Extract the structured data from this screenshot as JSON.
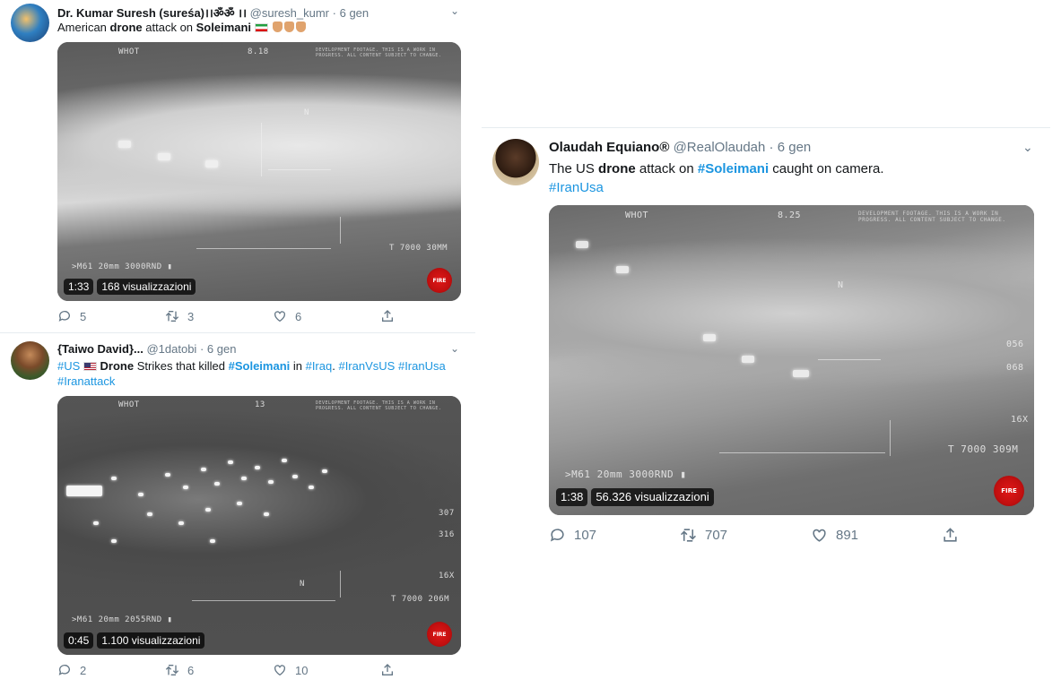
{
  "tweets": [
    {
      "name": "Dr. Kumar Suresh (sureśa)।।ॐॐ ।।",
      "handle": "@suresh_kumr",
      "time": "6 gen",
      "text": {
        "a": "American ",
        "b": "drone",
        "c": " attack on ",
        "d": "Soleimani"
      },
      "video": {
        "duration": "1:33",
        "views": "168 visualizzazioni"
      },
      "hud": {
        "mode": "WHOT",
        "top": "8.18",
        "north": "N",
        "range": "T 7000 30MM",
        "weapon": ">M61 20mm    3000RND ▮",
        "fire": "FIRE"
      },
      "actions": {
        "replies": "5",
        "retweets": "3",
        "likes": "6"
      }
    },
    {
      "name": "{Taiwo David}...",
      "handle": "@1datobi",
      "time": "6 gen",
      "text": {
        "t1": "#US",
        "t2": " ",
        "t3": "Drone",
        "t4": " Strikes that killed ",
        "t5": "#Soleimani",
        "t6": "  in ",
        "t7": "#Iraq",
        "t8": ". ",
        "t9": "#IranVsUS",
        "t10": " ",
        "t11": "#IranUsa",
        "t12": "#Iranattack"
      },
      "video": {
        "duration": "0:45",
        "views": "1.100 visualizzazioni"
      },
      "hud": {
        "mode": "WHOT",
        "top": "13",
        "r1": "307",
        "r2": "316",
        "r3": "16X",
        "north": "N",
        "range": "T 7000 206M",
        "weapon": ">M61 20mm    2055RND ▮",
        "fire": "FIRE"
      },
      "actions": {
        "replies": "2",
        "retweets": "6",
        "likes": "10"
      }
    },
    {
      "name": "Olaudah Equiano®",
      "handle": "@RealOlaudah",
      "time": "6 gen",
      "text": {
        "a": "The US ",
        "b": "drone",
        "c": " attack on ",
        "d": "#Soleimani",
        "e": " caught on camera.",
        "f": "#IranUsa"
      },
      "video": {
        "duration": "1:38",
        "views": "56.326 visualizzazioni"
      },
      "hud": {
        "mode": "WHOT",
        "top": "8.25",
        "r1": "056",
        "r2": "068",
        "r3": "16X",
        "north": "N",
        "range": "T 7000 309M",
        "weapon": ">M61 20mm    3000RND ▮",
        "fire": "FIRE"
      },
      "actions": {
        "replies": "107",
        "retweets": "707",
        "likes": "891"
      }
    }
  ],
  "dot": "·",
  "caret": "⌄",
  "hud_notice": "DEVELOPMENT FOOTAGE. THIS IS A WORK IN PROGRESS. ALL CONTENT SUBJECT TO CHANGE."
}
